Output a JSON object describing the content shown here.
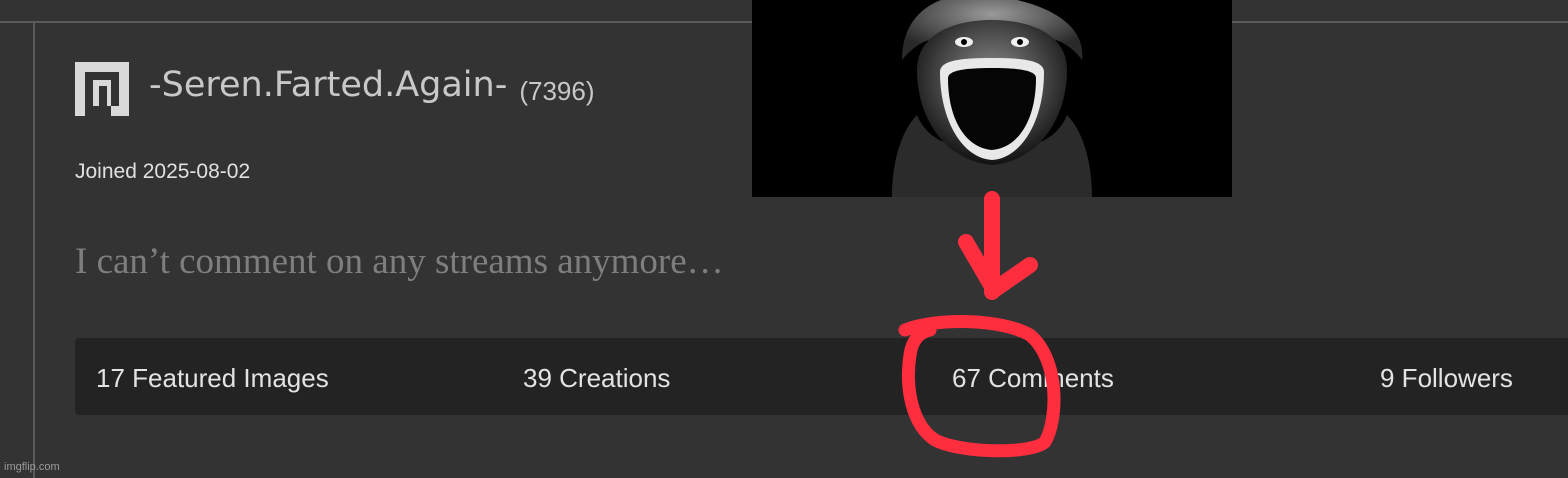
{
  "user": {
    "username": "-Seren.Farted.Again-",
    "points": "(7396)",
    "joined": "Joined 2025-08-02",
    "bio": "I can’t comment on any streams anymore…"
  },
  "stats": [
    {
      "label": "17 Featured Images"
    },
    {
      "label": "39 Creations"
    },
    {
      "label": "67 Comments"
    },
    {
      "label": "9 Followers"
    }
  ],
  "overlay": {
    "image": "screaming-face-photo",
    "arrow_color": "#ff2e3f",
    "circle_color": "#ff2e3f"
  },
  "watermark": "imgflip.com",
  "colors": {
    "background": "#333333",
    "stats_bar": "#232323",
    "annotation_red": "#ff2e3f"
  },
  "icons": {
    "logo": "imgflip-logo-icon"
  }
}
